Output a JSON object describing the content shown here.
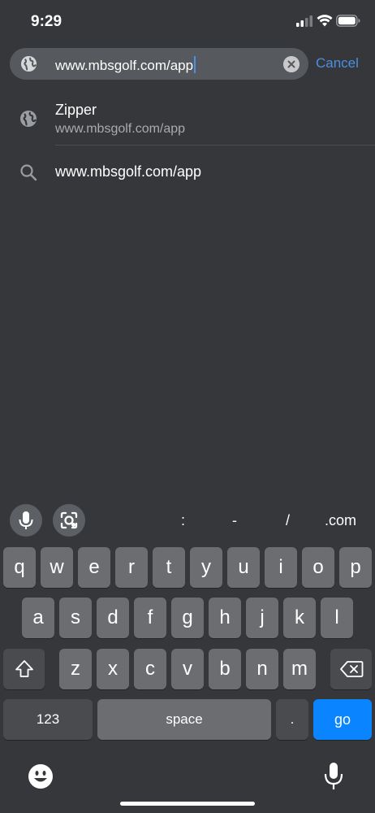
{
  "status_bar": {
    "time": "9:29"
  },
  "url_bar": {
    "value": "www.mbsgolf.com/app",
    "cancel_label": "Cancel"
  },
  "suggestions": [
    {
      "title": "Zipper",
      "subtitle": "www.mbsgolf.com/app",
      "icon": "globe-icon"
    },
    {
      "title": "www.mbsgolf.com/app",
      "icon": "search-icon"
    }
  ],
  "accessory": {
    "keys": [
      ":",
      "-",
      "/",
      ".com"
    ]
  },
  "keyboard": {
    "row1": [
      "q",
      "w",
      "e",
      "r",
      "t",
      "y",
      "u",
      "i",
      "o",
      "p"
    ],
    "row2": [
      "a",
      "s",
      "d",
      "f",
      "g",
      "h",
      "j",
      "k",
      "l"
    ],
    "row3": [
      "z",
      "x",
      "c",
      "v",
      "b",
      "n",
      "m"
    ],
    "numbers_label": "123",
    "space_label": "space",
    "period_label": ".",
    "go_label": "go"
  },
  "colors": {
    "accent": "#0a84ff",
    "link": "#4b8fe2",
    "background": "#35373a"
  }
}
